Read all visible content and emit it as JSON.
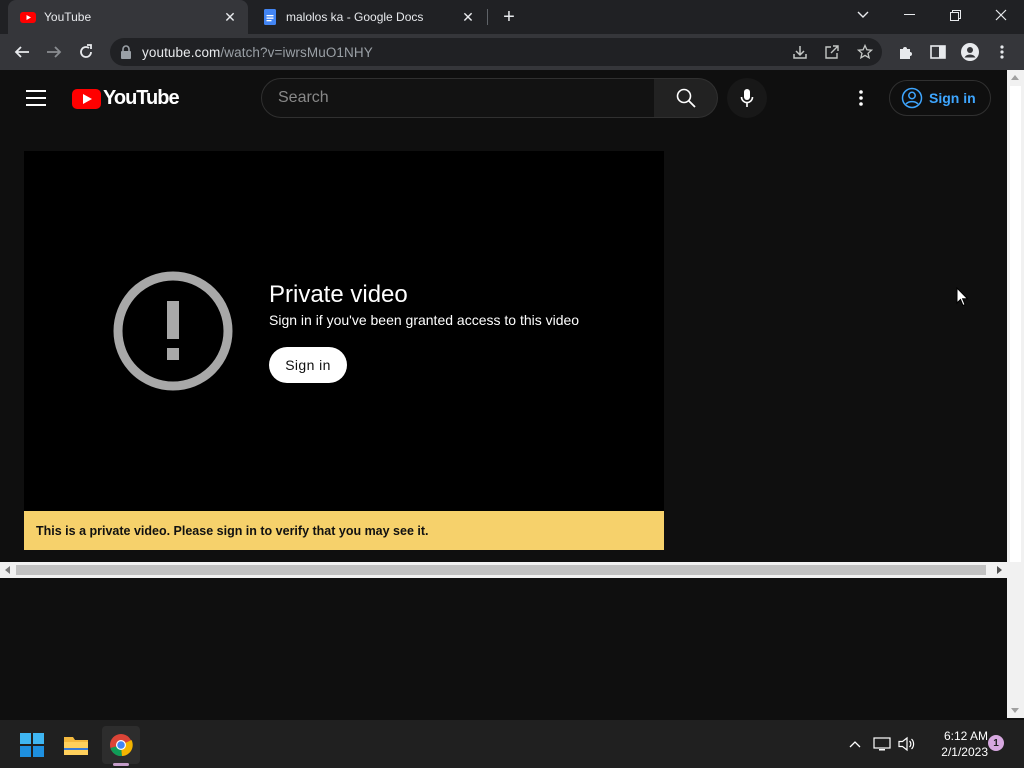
{
  "browser": {
    "tabs": [
      {
        "title": "YouTube",
        "active": true
      },
      {
        "title": "malolos ka - Google Docs",
        "active": false
      }
    ],
    "address": {
      "host": "youtube.com",
      "path": "/watch?v=iwrsMuO1NHY"
    }
  },
  "youtube": {
    "logo_text": "YouTube",
    "search_placeholder": "Search",
    "signin_label": "Sign in",
    "accent": "#3ea6ff",
    "brand_red": "#ff0000"
  },
  "player": {
    "title": "Private video",
    "subtitle": "Sign in if you've been granted access to this video",
    "signin_label": "Sign in",
    "banner": "This is a private video. Please sign in to verify that you may see it.",
    "banner_color": "#f6d16b"
  },
  "taskbar": {
    "time": "6:12 AM",
    "date": "2/1/2023",
    "notification_count": "1"
  }
}
